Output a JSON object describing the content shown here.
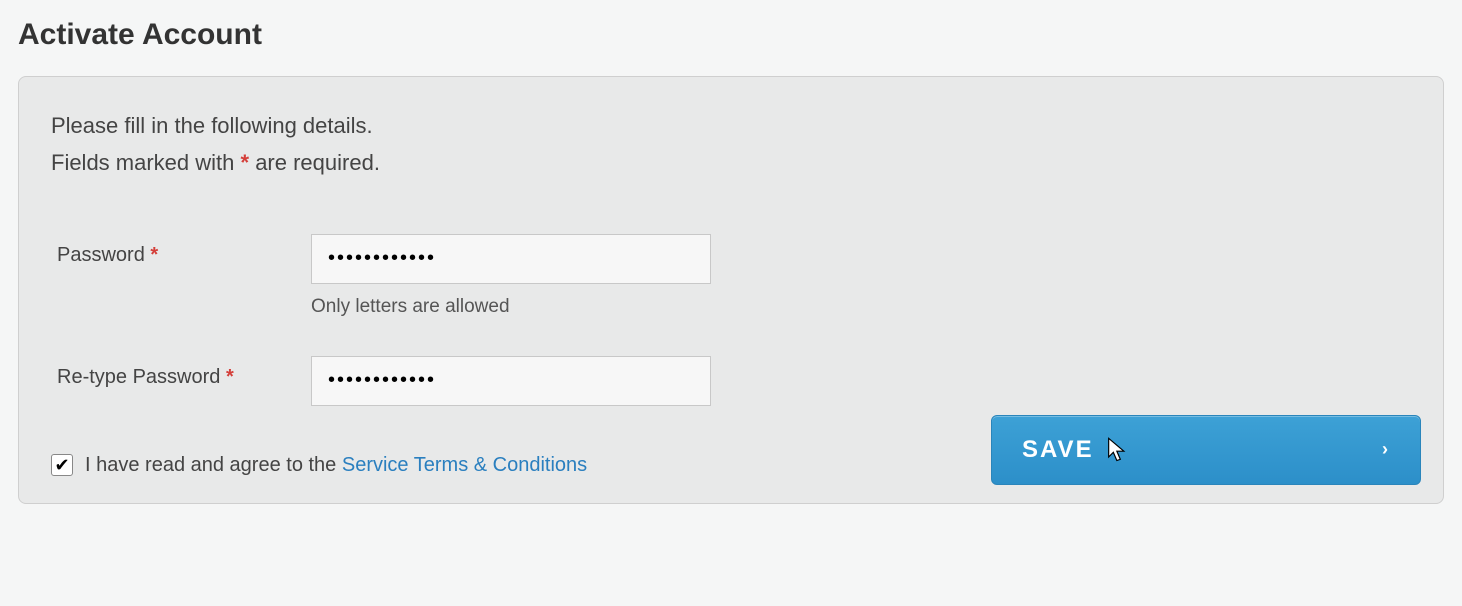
{
  "title": "Activate Account",
  "instructions": {
    "line1": "Please fill in the following details.",
    "line2_before": "Fields marked with ",
    "line2_mark": "*",
    "line2_after": " are required."
  },
  "form": {
    "password": {
      "label": "Password ",
      "required_mark": "*",
      "value": "●●●●●●●●●●●●",
      "hint": "Only letters are allowed"
    },
    "retype": {
      "label": "Re-type Password ",
      "required_mark": "*",
      "value": "●●●●●●●●●●●●"
    },
    "agree": {
      "checked": true,
      "text_before": "I have read and agree to the ",
      "link_text": "Service Terms & Conditions"
    },
    "save_label": "SAVE"
  }
}
